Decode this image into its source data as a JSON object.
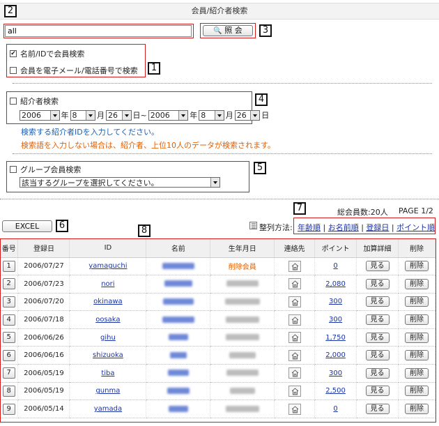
{
  "page": {
    "title": "会員/紹介者検索",
    "badges": [
      "1",
      "2",
      "3",
      "4",
      "5",
      "6",
      "7",
      "8"
    ]
  },
  "search": {
    "value": "all",
    "button_label": "照 会",
    "options": {
      "name_id": "名前/IDで会員検索",
      "email_phone": "会員を電子メール/電話番号で検索"
    }
  },
  "referrer": {
    "label": "紹介者検索",
    "from": {
      "year": "2006",
      "month": "8",
      "day": "26"
    },
    "to": {
      "year": "2006",
      "month": "8",
      "day": "26"
    },
    "unit_year": "年",
    "unit_month": "月",
    "unit_day": "日",
    "unit_day_tilde": "日~",
    "note1": "検索する紹介者IDを入力してください。",
    "note2": "検索語を入力しない場合は、紹介者、上位10人のデータが検索されます。"
  },
  "group": {
    "label": "グループ会員検索",
    "select_value": "該当するグループを選択してください。"
  },
  "list": {
    "excel_label": "EXCEL",
    "total": "総会員数:20人",
    "page": "PAGE 1/2",
    "sort_label": "整列方法:",
    "sort_options": [
      "年齢順",
      "お名前順",
      "登録日",
      "ポイント順"
    ]
  },
  "table": {
    "headers": [
      "番号",
      "登録日",
      "ID",
      "名前",
      "生年月日",
      "連絡先",
      "ポイント",
      "加算詳細",
      "削除"
    ],
    "view_label": "見る",
    "delete_label": "削除",
    "rows": [
      {
        "no": "1",
        "date": "2006/07/27",
        "id": "yamaguchi",
        "birth_text": "削除会員",
        "points": "0"
      },
      {
        "no": "2",
        "date": "2006/07/23",
        "id": "nori",
        "birth_text": "",
        "points": "2,080"
      },
      {
        "no": "3",
        "date": "2006/07/20",
        "id": "okinawa",
        "birth_text": "",
        "points": "300"
      },
      {
        "no": "4",
        "date": "2006/07/18",
        "id": "oosaka",
        "birth_text": "",
        "points": "300"
      },
      {
        "no": "5",
        "date": "2006/06/26",
        "id": "gihu",
        "birth_text": "",
        "points": "1,750"
      },
      {
        "no": "6",
        "date": "2006/06/16",
        "id": "shizuoka",
        "birth_text": "",
        "points": "2,000"
      },
      {
        "no": "7",
        "date": "2006/05/19",
        "id": "tiba",
        "birth_text": "",
        "points": "300"
      },
      {
        "no": "8",
        "date": "2006/05/19",
        "id": "gunma",
        "birth_text": "",
        "points": "2,500"
      },
      {
        "no": "9",
        "date": "2006/05/14",
        "id": "yamada",
        "birth_text": "",
        "points": "0"
      }
    ]
  }
}
